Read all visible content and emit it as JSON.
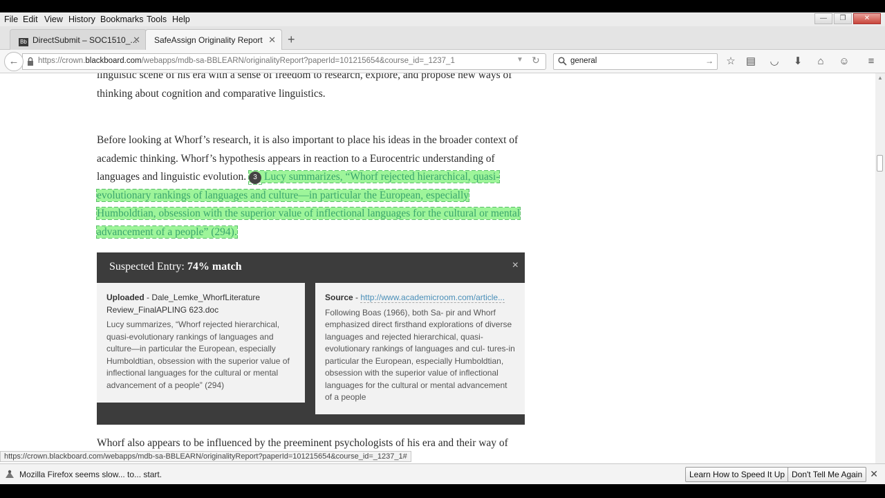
{
  "menu": [
    "File",
    "Edit",
    "View",
    "History",
    "Bookmarks",
    "Tools",
    "Help"
  ],
  "window_controls": {
    "minimize": "—",
    "restore": "❐",
    "close": "✕"
  },
  "tabs": [
    {
      "label": "DirectSubmit – SOC1510_...",
      "favicon": "Bb"
    },
    {
      "label": "SafeAssign Originality Report"
    }
  ],
  "new_tab_label": "+",
  "navbar": {
    "url_prefix": "https://crown.",
    "url_domain": "blackboard.com",
    "url_rest": "/webapps/mdb-sa-BBLEARN/originalityReport?paperId=101215654&course_id=_1237_1",
    "search_value": "general"
  },
  "content": {
    "para1": "linguistic scene of his era with a sense of freedom to research, explore, and propose new ways of thinking about cognition and comparative linguistics.",
    "para2_plain": "Before looking at Whorf’s research, it is also important to place his ideas in the broader context of academic thinking. Whorf’s hypothesis appears in reaction to a Eurocentric understanding of languages and linguistic evolution.",
    "match_badge": "3",
    "para2_highlight": "Lucy summarizes, “Whorf rejected hierarchical, quasi-evolutionary rankings of languages and culture—in particular the European, especially Humboldtian, obsession with the superior value of inflectional languages for the cultural or mental advancement of a people” (294).",
    "para3": "Whorf also appears to be influenced by the preeminent psychologists of his era and their way of thinking about language, emotion, and thought. Anderson writes, “Languages"
  },
  "match_panel": {
    "title_prefix": "Suspected Entry:",
    "title_match": "74% match",
    "close": "×",
    "uploaded_label": "Uploaded",
    "uploaded_file": "Dale_Lemke_WhorfLiterature Review_FinalAPLING 623.doc",
    "uploaded_text": "Lucy summarizes, “Whorf rejected hierarchical, quasi-evolutionary rankings of languages and culture—in particular the European, especially Humboldtian, obsession with the superior value of inflectional languages for the cultural or mental advancement of a people” (294)",
    "source_label": "Source",
    "source_url": "http://www.academicroom.com/article...",
    "source_text": "Following Boas (1966), both Sa- pir and Whorf emphasized direct firsthand explorations of diverse languages and rejected hierarchical, quasi-evolutionary rankings of languages and cul- tures-in particular the European, especially Humboldtian, obsession with the superior value of inflectional languages for the cultural or mental advancement of a people"
  },
  "status_url": "https://crown.blackboard.com/webapps/mdb-sa-BBLEARN/originalityReport?paperId=101215654&course_id=_1237_1#",
  "notification": {
    "text": "Mozilla Firefox seems slow... to... start.",
    "btn_speed": "Learn How to Speed It Up",
    "btn_dismiss": "Don't Tell Me Again",
    "close": "✕"
  }
}
